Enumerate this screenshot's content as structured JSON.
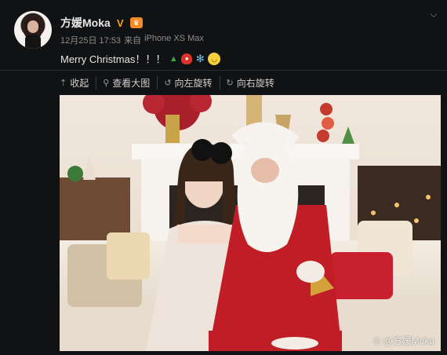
{
  "post": {
    "author": "方媛Moka",
    "verified_icon": "v-verified-icon",
    "level_icon": "member-level-icon",
    "date": "12月25日 17:53",
    "source_prefix": "来自",
    "source": "iPhone XS Max",
    "text": "Merry Christmas！！！",
    "emojis": [
      "christmas-tree",
      "santa",
      "snowflake",
      "smile"
    ]
  },
  "toolbar": {
    "collapse": "收起",
    "view_large": "查看大图",
    "rotate_left": "向左旋转",
    "rotate_right": "向右旋转"
  },
  "photo": {
    "watermark": "@方媛Moka"
  },
  "colors": {
    "background": "#111214",
    "verified": "#f4a623",
    "level_badge": "#f28b24"
  }
}
